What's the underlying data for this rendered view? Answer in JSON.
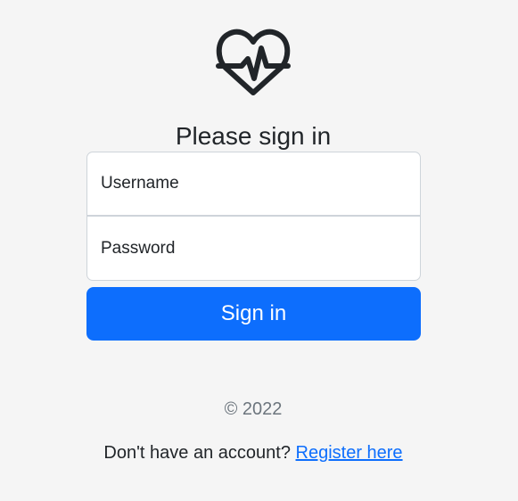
{
  "logo": {
    "icon": "heart-pulse-icon",
    "color": "#212529"
  },
  "title": "Please sign in",
  "form": {
    "username_placeholder": "Username",
    "password_placeholder": "Password",
    "submit_label": "Sign in"
  },
  "footer": {
    "copyright": "© 2022",
    "register_prompt": "Don't have an account?",
    "register_link": "Register here"
  },
  "colors": {
    "background": "#f5f5f5",
    "primary": "#0d6efd",
    "muted_text": "#6c757d"
  }
}
